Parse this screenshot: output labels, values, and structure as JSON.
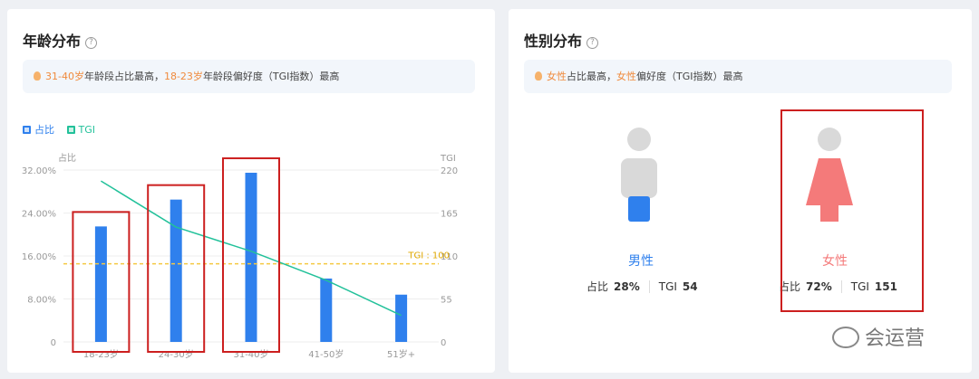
{
  "age_card": {
    "title": "年龄分布",
    "help_icon": "?",
    "insight": {
      "part1": "31-40岁",
      "part2": "年龄段占比最高，",
      "part3": "18-23岁",
      "part4": "年龄段偏好度（TGI指数）最高"
    },
    "legend": [
      {
        "label": "占比",
        "color": "#2f80ed"
      },
      {
        "label": "TGI",
        "color": "#22c19a"
      }
    ]
  },
  "chart_data": {
    "type": "bar",
    "categories": [
      "18-23岁",
      "24-30岁",
      "31-40岁",
      "41-50岁",
      "51岁+"
    ],
    "series": [
      {
        "name": "占比",
        "values": [
          21.5,
          26.5,
          31.5,
          11.8,
          8.8
        ],
        "color": "#2f80ed"
      },
      {
        "name": "TGI",
        "values": [
          206,
          147,
          116,
          79,
          34
        ],
        "color": "#22c19a"
      }
    ],
    "ylabel": "占比",
    "y2label": "TGI",
    "ylim": [
      0,
      32
    ],
    "y2lim": [
      0,
      220
    ],
    "yticks": [
      "0",
      "8.00%",
      "16.00%",
      "24.00%",
      "32.00%"
    ],
    "y2ticks": [
      "0",
      "55",
      "110",
      "165",
      "220"
    ],
    "reference_line": {
      "label": "TGI : 100",
      "value": 100,
      "color": "#f5c842"
    },
    "highlighted_categories": [
      "18-23岁",
      "24-30岁",
      "31-40岁"
    ]
  },
  "gender_card": {
    "title": "性别分布",
    "help_icon": "?",
    "insight": {
      "part1": "女性",
      "part2": "占比最高，",
      "part3": "女性",
      "part4": "偏好度（TGI指数）最高"
    },
    "male": {
      "label": "男性",
      "share_label": "占比",
      "share": "28%",
      "tgi_label": "TGI",
      "tgi": "54",
      "color": "#2f80ed"
    },
    "female": {
      "label": "女性",
      "share_label": "占比",
      "share": "72%",
      "tgi_label": "TGI",
      "tgi": "151",
      "color": "#f47a7a"
    }
  },
  "watermark": "会运营"
}
